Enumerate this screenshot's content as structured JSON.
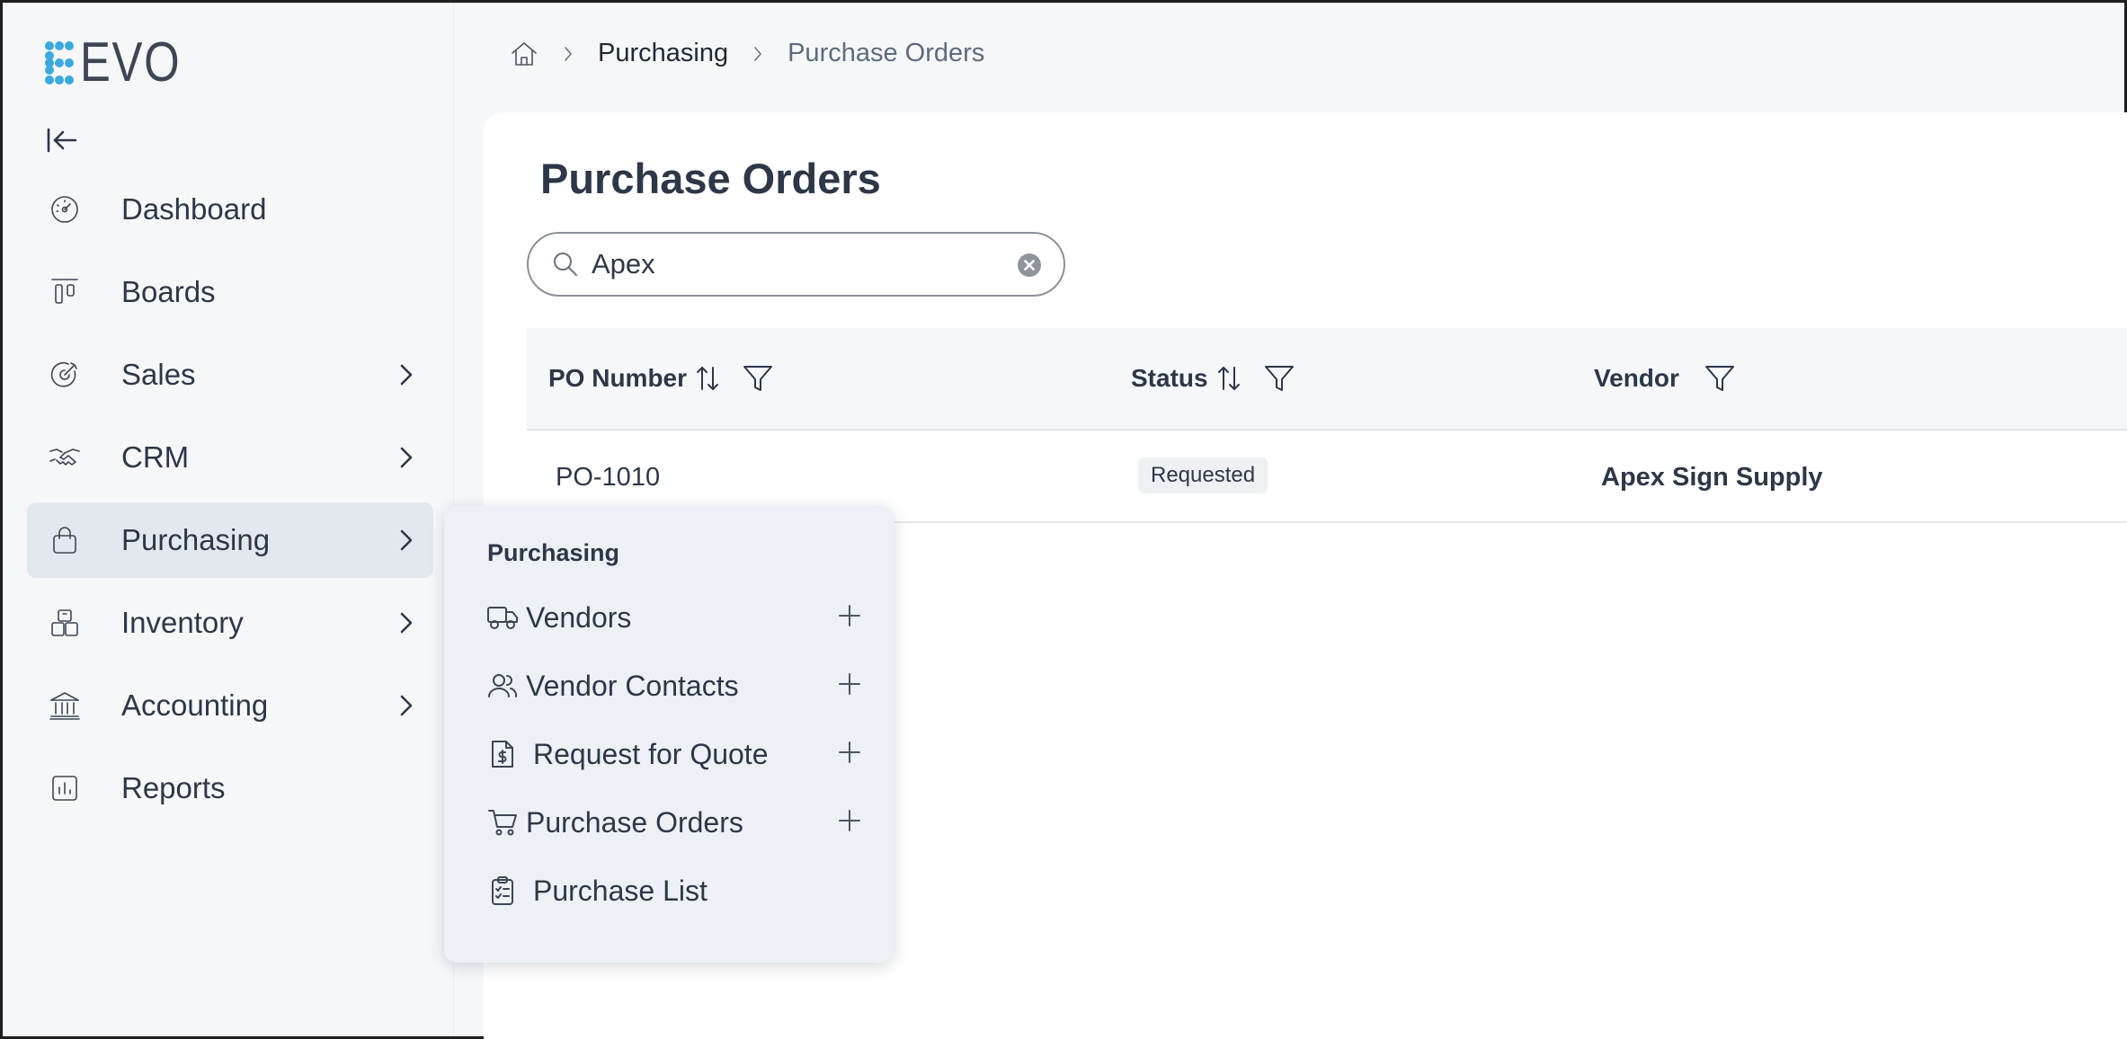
{
  "app": {
    "logo_text": "EVO"
  },
  "sidebar": {
    "items": [
      {
        "label": "Dashboard",
        "icon": "dashboard-gauge-icon",
        "has_children": false
      },
      {
        "label": "Boards",
        "icon": "boards-kanban-icon",
        "has_children": false
      },
      {
        "label": "Sales",
        "icon": "target-icon",
        "has_children": true
      },
      {
        "label": "CRM",
        "icon": "handshake-icon",
        "has_children": true
      },
      {
        "label": "Purchasing",
        "icon": "shopping-bag-icon",
        "has_children": true,
        "active": true
      },
      {
        "label": "Inventory",
        "icon": "boxes-icon",
        "has_children": true
      },
      {
        "label": "Accounting",
        "icon": "bank-icon",
        "has_children": true
      },
      {
        "label": "Reports",
        "icon": "bar-chart-icon",
        "has_children": false
      }
    ]
  },
  "breadcrumb": {
    "items": [
      "Purchasing",
      "Purchase Orders"
    ]
  },
  "page": {
    "title": "Purchase Orders"
  },
  "search": {
    "value": "Apex",
    "placeholder": ""
  },
  "table": {
    "columns": [
      "PO Number",
      "Status",
      "Vendor"
    ],
    "rows": [
      {
        "po_number": "PO-1010",
        "status": "Requested",
        "vendor": "Apex Sign Supply"
      }
    ]
  },
  "flyout": {
    "title": "Purchasing",
    "items": [
      {
        "label": "Vendors",
        "icon": "truck-icon",
        "has_add": true
      },
      {
        "label": "Vendor Contacts",
        "icon": "users-icon",
        "has_add": true
      },
      {
        "label": "Request for Quote",
        "icon": "invoice-dollar-icon",
        "has_add": true
      },
      {
        "label": "Purchase Orders",
        "icon": "cart-icon",
        "has_add": true
      },
      {
        "label": "Purchase List",
        "icon": "clipboard-list-icon",
        "has_add": false
      }
    ]
  },
  "colors": {
    "logo_accent": "#3aa9e0",
    "active_nav_bg": "#e3e8ef",
    "flyout_bg": "#edf1f6"
  }
}
